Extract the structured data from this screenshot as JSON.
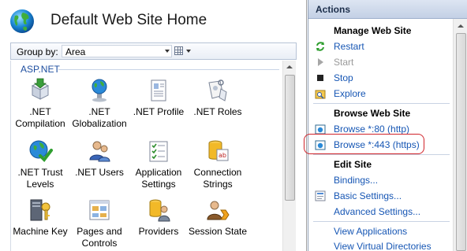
{
  "header": {
    "title": "Default Web Site Home"
  },
  "groupbar": {
    "label": "Group by:",
    "value": "Area"
  },
  "section": {
    "title": "ASP.NET"
  },
  "features": [
    {
      "label": ".NET\nCompilation",
      "icon": "compilation-icon"
    },
    {
      "label": ".NET\nGlobalization",
      "icon": "globalization-icon"
    },
    {
      "label": ".NET Profile",
      "icon": "profile-icon"
    },
    {
      "label": ".NET Roles",
      "icon": "roles-icon"
    },
    {
      "label": ".NET Trust\nLevels",
      "icon": "trust-levels-icon"
    },
    {
      "label": ".NET Users",
      "icon": "users-icon"
    },
    {
      "label": "Application\nSettings",
      "icon": "app-settings-icon"
    },
    {
      "label": "Connection\nStrings",
      "icon": "connection-strings-icon"
    },
    {
      "label": "Machine Key",
      "icon": "machine-key-icon"
    },
    {
      "label": "Pages and\nControls",
      "icon": "pages-controls-icon"
    },
    {
      "label": "Providers",
      "icon": "providers-icon"
    },
    {
      "label": "Session State",
      "icon": "session-state-icon"
    }
  ],
  "actions": {
    "title": "Actions",
    "manage": {
      "title": "Manage Web Site",
      "restart": "Restart",
      "start": "Start",
      "stop": "Stop",
      "explore": "Explore"
    },
    "browse": {
      "title": "Browse Web Site",
      "http": "Browse *:80 (http)",
      "https": "Browse *:443 (https)"
    },
    "edit": {
      "title": "Edit Site",
      "bindings": "Bindings...",
      "basic": "Basic Settings...",
      "advanced": "Advanced Settings..."
    },
    "view_applications": "View Applications",
    "view_virtual_directories": "View Virtual Directories"
  },
  "colors": {
    "link": "#1656b4",
    "highlight": "#d0232a",
    "section": "#1f4fa0"
  }
}
